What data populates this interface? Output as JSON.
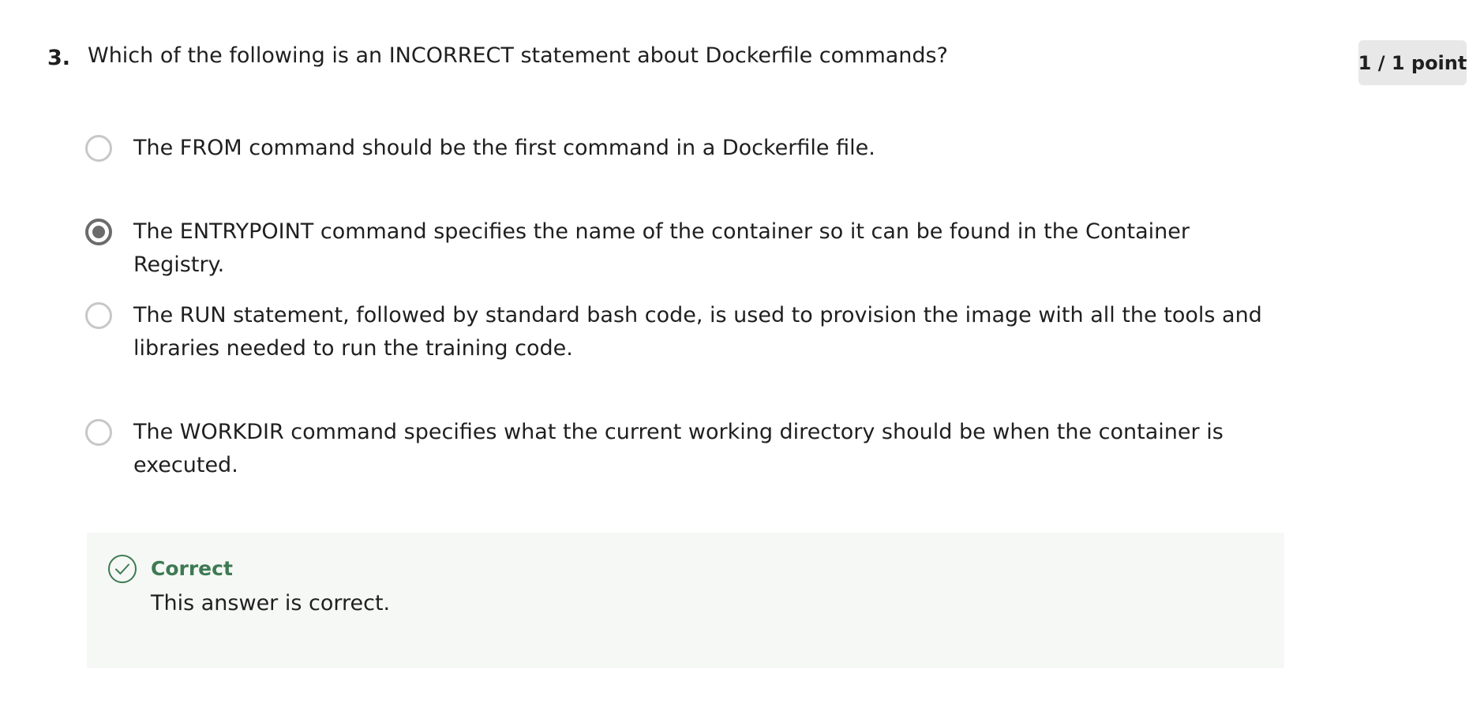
{
  "question": {
    "number": "3.",
    "text": "Which of the following is an INCORRECT statement about Dockerfile commands?",
    "score": "1 / 1 point"
  },
  "options": [
    {
      "label": "The FROM command should be the first command in a Dockerfile file.",
      "selected": false
    },
    {
      "label": "The ENTRYPOINT command specifies the name of the container so it can be found in the Container Registry.",
      "selected": true
    },
    {
      "label": "The RUN statement, followed by standard bash code, is used to provision the image with all the tools and libraries needed to run the training code.",
      "selected": false
    },
    {
      "label": "The WORKDIR command specifies what the current working directory should be when the container is executed.",
      "selected": false
    }
  ],
  "feedback": {
    "icon": "check-circle-icon",
    "title": "Correct",
    "text": "This answer is correct."
  },
  "colors": {
    "correct_green": "#3d7a52",
    "feedback_background": "#f6f8f6",
    "selected_radio": "#6b6b6b",
    "unselected_radio": "#c7c7c7",
    "score_badge_background": "#e8e8e8"
  }
}
